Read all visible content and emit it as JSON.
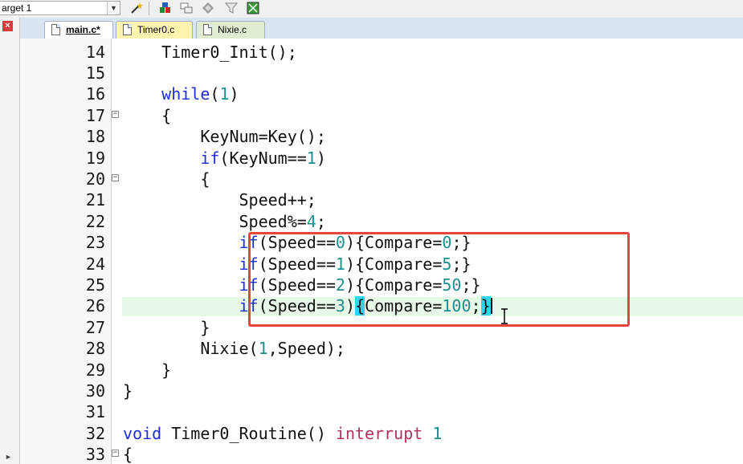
{
  "toolbar": {
    "target_value": "arget 1",
    "icons": [
      "dropdown-arrow",
      "magic-wand-icon",
      "load-icon",
      "manage-icon",
      "diamond-icon",
      "funnel-icon",
      "grid-icon"
    ]
  },
  "tabs": [
    {
      "label": "main.c*",
      "active": true,
      "color": "#ffffff"
    },
    {
      "label": "Timer0.c",
      "active": false,
      "color": "#fff3b0"
    },
    {
      "label": "Nixie.c",
      "active": false,
      "color": "#dfeccf"
    }
  ],
  "editor": {
    "current_line": 26,
    "lines": [
      {
        "n": "14",
        "text": "    Timer0_Init();"
      },
      {
        "n": "15",
        "text": ""
      },
      {
        "n": "16",
        "text": "    while(1)"
      },
      {
        "n": "17",
        "text": "    {"
      },
      {
        "n": "18",
        "text": "        KeyNum=Key();"
      },
      {
        "n": "19",
        "text": "        if(KeyNum==1)"
      },
      {
        "n": "20",
        "text": "        {"
      },
      {
        "n": "21",
        "text": "            Speed++;"
      },
      {
        "n": "22",
        "text": "            Speed%=4;"
      },
      {
        "n": "23",
        "text": "            if(Speed==0){Compare=0;}"
      },
      {
        "n": "24",
        "text": "            if(Speed==1){Compare=5;}"
      },
      {
        "n": "25",
        "text": "            if(Speed==2){Compare=50;}"
      },
      {
        "n": "26",
        "text": "            if(Speed==3){Compare=100;}"
      },
      {
        "n": "27",
        "text": "        }"
      },
      {
        "n": "28",
        "text": "        Nixie(1,Speed);"
      },
      {
        "n": "29",
        "text": "    }"
      },
      {
        "n": "30",
        "text": "}"
      },
      {
        "n": "31",
        "text": ""
      },
      {
        "n": "32",
        "text": "void Timer0_Routine() interrupt 1"
      },
      {
        "n": "33",
        "text": "{"
      }
    ],
    "fold_markers": [
      "17",
      "20",
      "33"
    ]
  },
  "colors": {
    "keyword": "#1d2ee0",
    "number": "#1c8f8f",
    "interrupt_keyword": "#b0325a",
    "brace_match": "#34d2f0",
    "current_line_bg": "#e8f8e8",
    "annotation_box": "#e8453f"
  }
}
